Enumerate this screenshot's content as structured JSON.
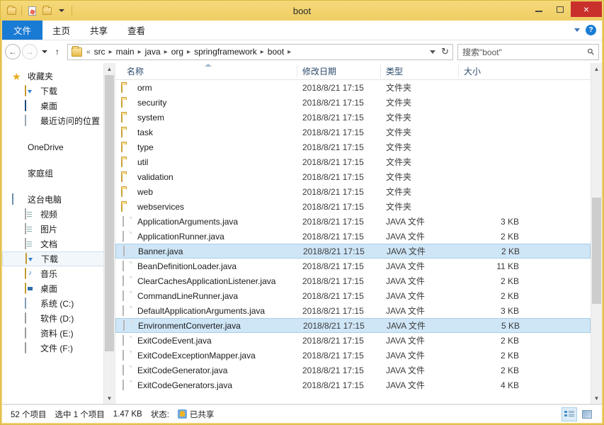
{
  "window": {
    "title": "boot",
    "quick_access": [
      "folder-icon",
      "new-folder-icon",
      "properties-icon",
      "customize-dropdown-icon"
    ],
    "controls": {
      "minimize": "minimize-icon",
      "maximize": "maximize-icon",
      "close": "×"
    },
    "accent_color": "#f0d070",
    "close_color": "#c9302c"
  },
  "ribbon": {
    "tabs": [
      {
        "label": "文件",
        "active": true
      },
      {
        "label": "主页",
        "active": false
      },
      {
        "label": "共享",
        "active": false
      },
      {
        "label": "查看",
        "active": false
      }
    ],
    "expand_icon": "chevron-down-icon",
    "help_label": "?"
  },
  "address_bar": {
    "back": "←",
    "forward": "→",
    "history": "▾",
    "up": "↑",
    "overflow": "«",
    "crumbs": [
      "src",
      "main",
      "java",
      "org",
      "springframework",
      "boot"
    ],
    "separator": "▸",
    "dropdown_icon": "chevron-down-icon",
    "refresh_icon": "↻",
    "search_placeholder": "搜索\"boot\"",
    "search_value": ""
  },
  "sidebar": {
    "groups": [
      {
        "header": {
          "label": "收藏夹",
          "icon": "star-icon"
        },
        "items": [
          {
            "label": "下载",
            "icon": "download-folder-icon"
          },
          {
            "label": "桌面",
            "icon": "desktop-icon"
          },
          {
            "label": "最近访问的位置",
            "icon": "recent-places-icon"
          }
        ]
      },
      {
        "header": {
          "label": "OneDrive",
          "icon": "onedrive-icon"
        },
        "items": []
      },
      {
        "header": {
          "label": "家庭组",
          "icon": "homegroup-icon"
        },
        "items": []
      },
      {
        "header": {
          "label": "这台电脑",
          "icon": "this-pc-icon"
        },
        "items": [
          {
            "label": "视频",
            "icon": "videos-icon",
            "selected": false
          },
          {
            "label": "图片",
            "icon": "pictures-icon",
            "selected": false
          },
          {
            "label": "文档",
            "icon": "documents-icon",
            "selected": false
          },
          {
            "label": "下载",
            "icon": "downloads-icon",
            "selected": true
          },
          {
            "label": "音乐",
            "icon": "music-icon",
            "selected": false
          },
          {
            "label": "桌面",
            "icon": "desktop-folder-icon",
            "selected": false
          },
          {
            "label": "系统 (C:)",
            "icon": "system-drive-icon",
            "selected": false
          },
          {
            "label": "软件 (D:)",
            "icon": "drive-icon",
            "selected": false
          },
          {
            "label": "资料 (E:)",
            "icon": "drive-icon",
            "selected": false
          },
          {
            "label": "文件 (F:)",
            "icon": "drive-icon",
            "selected": false
          }
        ]
      }
    ]
  },
  "file_list": {
    "columns": [
      {
        "key": "name",
        "label": "名称",
        "sorted": true
      },
      {
        "key": "date",
        "label": "修改日期"
      },
      {
        "key": "type",
        "label": "类型"
      },
      {
        "key": "size",
        "label": "大小"
      }
    ],
    "rows": [
      {
        "name": "orm",
        "date": "2018/8/21 17:15",
        "type": "文件夹",
        "size": "",
        "icon": "folder-icon",
        "selected": false
      },
      {
        "name": "security",
        "date": "2018/8/21 17:15",
        "type": "文件夹",
        "size": "",
        "icon": "folder-icon",
        "selected": false
      },
      {
        "name": "system",
        "date": "2018/8/21 17:15",
        "type": "文件夹",
        "size": "",
        "icon": "folder-icon",
        "selected": false
      },
      {
        "name": "task",
        "date": "2018/8/21 17:15",
        "type": "文件夹",
        "size": "",
        "icon": "folder-icon",
        "selected": false
      },
      {
        "name": "type",
        "date": "2018/8/21 17:15",
        "type": "文件夹",
        "size": "",
        "icon": "folder-icon",
        "selected": false
      },
      {
        "name": "util",
        "date": "2018/8/21 17:15",
        "type": "文件夹",
        "size": "",
        "icon": "folder-icon",
        "selected": false
      },
      {
        "name": "validation",
        "date": "2018/8/21 17:15",
        "type": "文件夹",
        "size": "",
        "icon": "folder-icon",
        "selected": false
      },
      {
        "name": "web",
        "date": "2018/8/21 17:15",
        "type": "文件夹",
        "size": "",
        "icon": "folder-icon",
        "selected": false
      },
      {
        "name": "webservices",
        "date": "2018/8/21 17:15",
        "type": "文件夹",
        "size": "",
        "icon": "folder-icon",
        "selected": false
      },
      {
        "name": "ApplicationArguments.java",
        "date": "2018/8/21 17:15",
        "type": "JAVA 文件",
        "size": "3 KB",
        "icon": "java-file-icon",
        "selected": false
      },
      {
        "name": "ApplicationRunner.java",
        "date": "2018/8/21 17:15",
        "type": "JAVA 文件",
        "size": "2 KB",
        "icon": "java-file-icon",
        "selected": false
      },
      {
        "name": "Banner.java",
        "date": "2018/8/21 17:15",
        "type": "JAVA 文件",
        "size": "2 KB",
        "icon": "java-file-icon",
        "selected": true
      },
      {
        "name": "BeanDefinitionLoader.java",
        "date": "2018/8/21 17:15",
        "type": "JAVA 文件",
        "size": "11 KB",
        "icon": "java-file-icon",
        "selected": false
      },
      {
        "name": "ClearCachesApplicationListener.java",
        "date": "2018/8/21 17:15",
        "type": "JAVA 文件",
        "size": "2 KB",
        "icon": "java-file-icon",
        "selected": false
      },
      {
        "name": "CommandLineRunner.java",
        "date": "2018/8/21 17:15",
        "type": "JAVA 文件",
        "size": "2 KB",
        "icon": "java-file-icon",
        "selected": false
      },
      {
        "name": "DefaultApplicationArguments.java",
        "date": "2018/8/21 17:15",
        "type": "JAVA 文件",
        "size": "3 KB",
        "icon": "java-file-icon",
        "selected": false
      },
      {
        "name": "EnvironmentConverter.java",
        "date": "2018/8/21 17:15",
        "type": "JAVA 文件",
        "size": "5 KB",
        "icon": "java-file-icon",
        "selected": true
      },
      {
        "name": "ExitCodeEvent.java",
        "date": "2018/8/21 17:15",
        "type": "JAVA 文件",
        "size": "2 KB",
        "icon": "java-file-icon",
        "selected": false
      },
      {
        "name": "ExitCodeExceptionMapper.java",
        "date": "2018/8/21 17:15",
        "type": "JAVA 文件",
        "size": "2 KB",
        "icon": "java-file-icon",
        "selected": false
      },
      {
        "name": "ExitCodeGenerator.java",
        "date": "2018/8/21 17:15",
        "type": "JAVA 文件",
        "size": "2 KB",
        "icon": "java-file-icon",
        "selected": false
      },
      {
        "name": "ExitCodeGenerators.java",
        "date": "2018/8/21 17:15",
        "type": "JAVA 文件",
        "size": "4 KB",
        "icon": "java-file-icon",
        "selected": false
      }
    ]
  },
  "status_bar": {
    "item_count": "52 个项目",
    "selection": "选中 1 个项目",
    "selection_size": "1.47 KB",
    "state_label": "状态:",
    "shared_label": "已共享",
    "views": [
      {
        "name": "details-view",
        "active": true
      },
      {
        "name": "large-icons-view",
        "active": false
      }
    ]
  }
}
